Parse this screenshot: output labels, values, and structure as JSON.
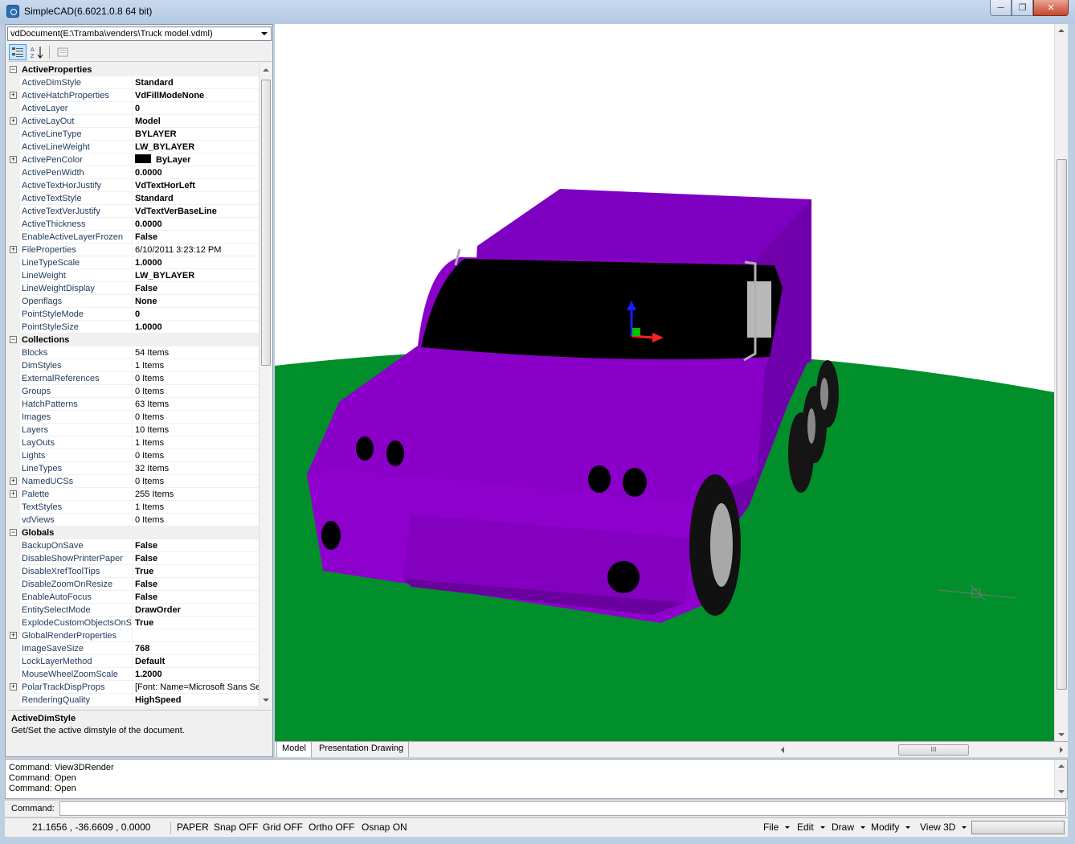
{
  "window": {
    "title": "SimpleCAD(6.6021.0.8  64 bit)",
    "min_icon": "minimize-icon",
    "max_icon": "maximize-icon",
    "close_icon": "close-icon"
  },
  "document_selector": "vdDocument(E:\\Tramba\\venders\\Truck model.vdml)",
  "property_grid": {
    "rows": [
      {
        "kind": "cat",
        "name": "ActiveProperties",
        "expander": "−"
      },
      {
        "name": "ActiveDimStyle",
        "value": "Standard",
        "bold": true
      },
      {
        "name": "ActiveHatchProperties",
        "value": "VdFillModeNone",
        "bold": true,
        "expander": "+"
      },
      {
        "name": "ActiveLayer",
        "value": "0",
        "bold": true
      },
      {
        "name": "ActiveLayOut",
        "value": "Model",
        "bold": true,
        "expander": "+"
      },
      {
        "name": "ActiveLineType",
        "value": "BYLAYER",
        "bold": true
      },
      {
        "name": "ActiveLineWeight",
        "value": "LW_BYLAYER",
        "bold": true
      },
      {
        "name": "ActivePenColor",
        "value": "ByLayer",
        "bold": true,
        "expander": "+",
        "swatch": "#000000"
      },
      {
        "name": "ActivePenWidth",
        "value": "0.0000",
        "bold": true
      },
      {
        "name": "ActiveTextHorJustify",
        "value": "VdTextHorLeft",
        "bold": true
      },
      {
        "name": "ActiveTextStyle",
        "value": "Standard",
        "bold": true
      },
      {
        "name": "ActiveTextVerJustify",
        "value": "VdTextVerBaseLine",
        "bold": true
      },
      {
        "name": "ActiveThickness",
        "value": "0.0000",
        "bold": true
      },
      {
        "name": "EnableActiveLayerFrozen",
        "value": "False",
        "bold": true
      },
      {
        "name": "FileProperties",
        "value": "6/10/2011 3:23:12 PM",
        "bold": false,
        "expander": "+"
      },
      {
        "name": "LineTypeScale",
        "value": "1.0000",
        "bold": true
      },
      {
        "name": "LineWeight",
        "value": "LW_BYLAYER",
        "bold": true
      },
      {
        "name": "LineWeightDisplay",
        "value": "False",
        "bold": true
      },
      {
        "name": "Openflags",
        "value": "None",
        "bold": true
      },
      {
        "name": "PointStyleMode",
        "value": "0",
        "bold": true
      },
      {
        "name": "PointStyleSize",
        "value": "1.0000",
        "bold": true
      },
      {
        "kind": "cat",
        "name": "Collections",
        "expander": "−"
      },
      {
        "name": "Blocks",
        "value": "54 Items",
        "bold": false
      },
      {
        "name": "DimStyles",
        "value": "1 Items",
        "bold": false
      },
      {
        "name": "ExternalReferences",
        "value": "0 Items",
        "bold": false
      },
      {
        "name": "Groups",
        "value": "0 Items",
        "bold": false
      },
      {
        "name": "HatchPatterns",
        "value": "63 Items",
        "bold": false
      },
      {
        "name": "Images",
        "value": "0 Items",
        "bold": false
      },
      {
        "name": "Layers",
        "value": "10 Items",
        "bold": false
      },
      {
        "name": "LayOuts",
        "value": "1 Items",
        "bold": false
      },
      {
        "name": "Lights",
        "value": "0 Items",
        "bold": false
      },
      {
        "name": "LineTypes",
        "value": "32 Items",
        "bold": false
      },
      {
        "name": "NamedUCSs",
        "value": "0 Items",
        "bold": false,
        "expander": "+"
      },
      {
        "name": "Palette",
        "value": "255 Items",
        "bold": false,
        "expander": "+"
      },
      {
        "name": "TextStyles",
        "value": "1 Items",
        "bold": false
      },
      {
        "name": "vdViews",
        "value": "0 Items",
        "bold": false
      },
      {
        "kind": "cat",
        "name": "Globals",
        "expander": "−"
      },
      {
        "name": "BackupOnSave",
        "value": "False",
        "bold": true
      },
      {
        "name": "DisableShowPrinterPaper",
        "value": "False",
        "bold": true
      },
      {
        "name": "DisableXrefToolTips",
        "value": "True",
        "bold": true
      },
      {
        "name": "DisableZoomOnResize",
        "value": "False",
        "bold": true
      },
      {
        "name": "EnableAutoFocus",
        "value": "False",
        "bold": true
      },
      {
        "name": "EntitySelectMode",
        "value": "DrawOrder",
        "bold": true
      },
      {
        "name": "ExplodeCustomObjectsOnSa",
        "value": "True",
        "bold": true
      },
      {
        "name": "GlobalRenderProperties",
        "value": "",
        "bold": false,
        "expander": "+"
      },
      {
        "name": "ImageSaveSize",
        "value": "768",
        "bold": true
      },
      {
        "name": "LockLayerMethod",
        "value": "Default",
        "bold": true
      },
      {
        "name": "MouseWheelZoomScale",
        "value": "1.2000",
        "bold": true
      },
      {
        "name": "PolarTrackDispProps",
        "value": "[Font: Name=Microsoft Sans Se",
        "bold": false,
        "expander": "+"
      },
      {
        "name": "RenderingQuality",
        "value": "HighSpeed",
        "bold": true
      }
    ]
  },
  "description": {
    "title": "ActiveDimStyle",
    "text": "Get/Set the active dimstyle of the document."
  },
  "viewport": {
    "ground_color": "#008f2a",
    "truck_color": "#8a00c8",
    "windshield_color": "#000000",
    "background_color": "#ffffff"
  },
  "tabs": [
    {
      "label": "Model",
      "active": true
    },
    {
      "label": "Presentation Drawing",
      "active": false
    }
  ],
  "hscroll_grip": "III",
  "command_history": [
    "Command: View3DRender",
    "Command: Open",
    "Command: Open"
  ],
  "command_label": "Command:",
  "statusbar": {
    "coords": "21.1656 , -36.6609 , 0.0000",
    "paper": "PAPER",
    "snap": "Snap OFF",
    "grid": "Grid OFF",
    "ortho": "Ortho OFF",
    "osnap": "Osnap ON",
    "menus": [
      "File",
      "Edit",
      "Draw",
      "Modify",
      "View 3D"
    ]
  }
}
